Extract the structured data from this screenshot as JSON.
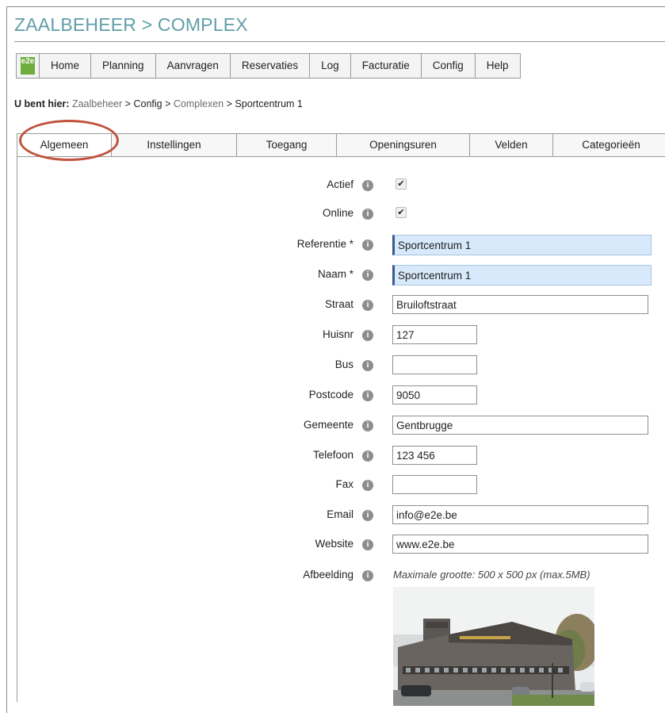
{
  "page": {
    "title": "ZAALBEHEER > COMPLEX"
  },
  "menu": {
    "logo_text": "e2e",
    "items": [
      "Home",
      "Planning",
      "Aanvragen",
      "Reservaties",
      "Log",
      "Facturatie",
      "Config",
      "Help"
    ]
  },
  "breadcrumb": {
    "prefix": "U bent hier:",
    "zaalbeheer": "Zaalbeheer",
    "sep1": ">",
    "config": "Config",
    "sep2": ">",
    "complexen": "Complexen",
    "sep3": ">",
    "current": "Sportcentrum 1"
  },
  "tabs": [
    "Algemeen",
    "Instellingen",
    "Toegang",
    "Openingsuren",
    "Velden",
    "Categorieën"
  ],
  "active_tab": "Algemeen",
  "form": {
    "actief": {
      "label": "Actief",
      "checked": true
    },
    "online": {
      "label": "Online",
      "checked": true
    },
    "referentie": {
      "label": "Referentie *",
      "value": "Sportcentrum 1"
    },
    "naam": {
      "label": "Naam *",
      "value": "Sportcentrum 1"
    },
    "straat": {
      "label": "Straat",
      "value": "Bruiloftstraat"
    },
    "huisnr": {
      "label": "Huisnr",
      "value": "127"
    },
    "bus": {
      "label": "Bus",
      "value": ""
    },
    "postcode": {
      "label": "Postcode",
      "value": "9050"
    },
    "gemeente": {
      "label": "Gemeente",
      "value": "Gentbrugge"
    },
    "telefoon": {
      "label": "Telefoon",
      "value": "123 456"
    },
    "fax": {
      "label": "Fax",
      "value": ""
    },
    "email": {
      "label": "Email",
      "value": "info@e2e.be"
    },
    "website": {
      "label": "Website",
      "value": "www.e2e.be"
    },
    "afbeelding": {
      "label": "Afbeelding",
      "hint": "Maximale grootte: 500 x 500 px (max.5MB)"
    },
    "info_glyph": "i",
    "check_glyph": "✔"
  },
  "colors": {
    "title": "#5f9ea8",
    "required_bg": "#d7e9fb",
    "highlight_circle": "#c0533e",
    "logo_green": "#6fae3c"
  }
}
